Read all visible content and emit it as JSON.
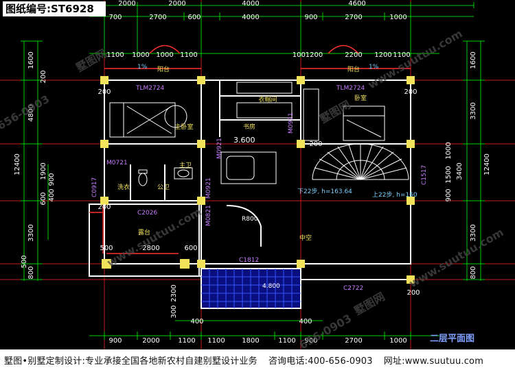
{
  "drawing_number": "图纸编号:ST6928",
  "floor_title": "二层平面图",
  "footer": {
    "company": "墅图•别墅定制设计:专业承接全国各地新农村自建别墅设计业务",
    "phone": "咨询电话:400-656-0903",
    "website": "网址:www.suutuu.com"
  },
  "watermarks": {
    "brand": "墅图网",
    "url": "www.suutuu.com",
    "phone_fragment": "656-0903"
  },
  "dimensions": {
    "top_row1": [
      "2000",
      "2000",
      "4000",
      "4600"
    ],
    "top_row2": [
      "700",
      "2700",
      "600",
      "4000",
      "900",
      "2700",
      "1000"
    ],
    "top_row3_left": [
      "1100",
      "1000",
      "1000",
      "1100"
    ],
    "top_row3_right": [
      "1001200",
      "2200",
      "1200",
      "1100"
    ],
    "bottom_row1": [
      "900",
      "2000",
      "1100",
      "1100",
      "1800",
      "1100",
      "900",
      "2700",
      "1000"
    ],
    "bottom_row2": [
      "400",
      "400"
    ],
    "left_outer": [
      "1600",
      "4800",
      "3300",
      "800"
    ],
    "left_total": "12400",
    "left_inner": [
      "200",
      "1900",
      "600",
      "900",
      "400"
    ],
    "right_outer": [
      "1600",
      "3300",
      "3300",
      "800"
    ],
    "right_total": "12400",
    "right_inner": [
      "1000",
      "1500",
      "900",
      "3400"
    ],
    "misc": [
      "500",
      "500",
      "2800",
      "600",
      "200",
      "200",
      "200",
      "200",
      "200",
      "2300",
      "300"
    ]
  },
  "labels": {
    "balcony_left": "阳台",
    "balcony_right": "阳台",
    "slope_left": "1%",
    "slope_right": "1%",
    "master_bedroom": "主卧室",
    "bedroom": "卧室",
    "closet": "衣帽间",
    "study": "书房",
    "linen": "洗衣",
    "public_wc": "公卫",
    "master_wc": "主卫",
    "terrace": "露台",
    "void": "中空",
    "stairs_down": "下22步, h=163.64",
    "stairs_up": "上22步, h=160",
    "elevation": "3.600",
    "radius": "R800",
    "area_tag": "4.800"
  },
  "openings": {
    "tlm_left": "TLM2724",
    "tlm_right": "TLM2724",
    "m0721": "M0721",
    "m0921_a": "M0921",
    "m0921_b": "M0921",
    "m0921_c": "M0921",
    "m0821": "M0821",
    "c0917": "C0917",
    "c2026": "C2026",
    "c1812": "C1812",
    "c2722": "C2722",
    "c1517": "C1517"
  },
  "colors": {
    "background": "#000000",
    "axis_line": "#d01b1b",
    "dimension": "#00d000",
    "wall": "#ffffff",
    "column": "#f2e35a",
    "door_text": "#c77dff",
    "room_text": "#f2e35a",
    "label_cyan": "#7fd0ff",
    "terrace_grid": "#2a40ff"
  },
  "icons": [
    "stair-spiral-icon",
    "bed-icon",
    "bathtub-icon",
    "toilet-icon",
    "sink-icon",
    "north-arrow-icon"
  ]
}
